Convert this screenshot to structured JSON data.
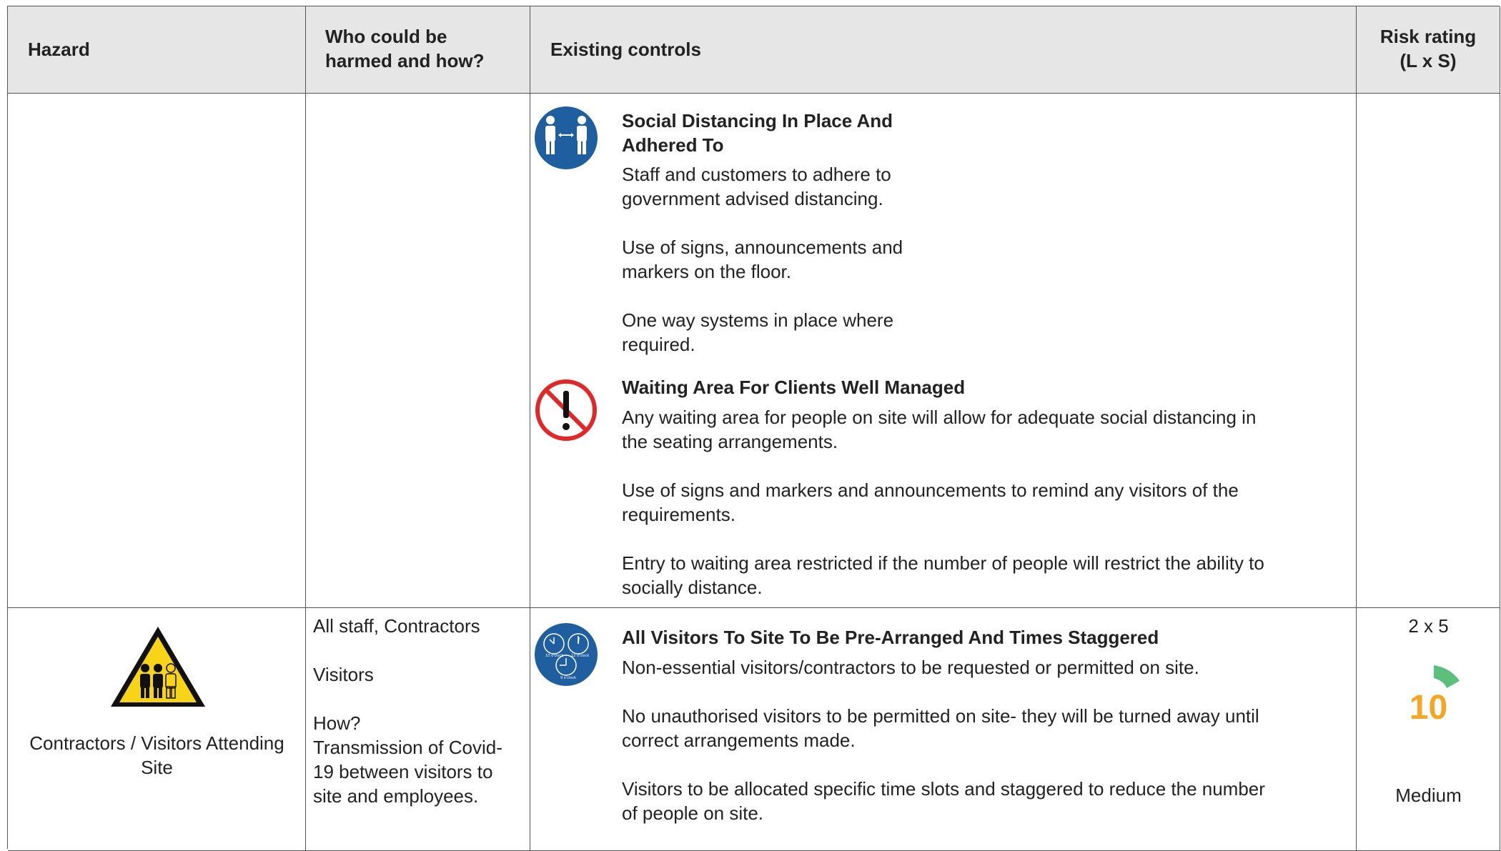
{
  "header": {
    "hazard": "Hazard",
    "who_line1": "Who could be",
    "who_line2": "harmed and how?",
    "controls": "Existing controls",
    "risk_line1": "Risk rating",
    "risk_line2": "(L x S)"
  },
  "row1": {
    "controls": [
      {
        "icon": "social-distancing-icon",
        "title_line1": "Social Distancing In Place And",
        "title_line2": "Adhered To",
        "paragraphs": [
          [
            "Staff and customers to adhere to",
            "government advised distancing."
          ],
          [
            "Use of signs, announcements and",
            "markers on the floor."
          ],
          [
            "One way systems in place where",
            "required."
          ]
        ]
      },
      {
        "icon": "no-waiting-warning-icon",
        "title": "Waiting Area For Clients Well Managed",
        "paragraphs": [
          [
            "Any waiting area for people on site will allow for adequate social distancing in",
            "the seating arrangements."
          ],
          [
            "Use of signs and markers and announcements to remind any visitors of the",
            "requirements."
          ],
          [
            "Entry to waiting area restricted if the number of people will restrict the ability to",
            "socially distance."
          ]
        ]
      }
    ]
  },
  "row2": {
    "hazard_icon": "visitors-warning-triangle-icon",
    "hazard_line1": "Contractors / Visitors Attending",
    "hazard_line2": "Site",
    "who": {
      "line1": "All staff, Contractors",
      "line2": "Visitors",
      "how_label": "How?",
      "how_lines": [
        "Transmission of Covid-",
        "19 between visitors to",
        "site and employees."
      ]
    },
    "control": {
      "icon": "staggered-times-clock-icon",
      "clock_labels": [
        "10 o'clock",
        "12 o'clock",
        "9 o'clock"
      ],
      "title": "All Visitors To Site To Be Pre-Arranged And Times Staggered",
      "paragraphs": [
        [
          "Non-essential visitors/contractors to be requested or permitted on site."
        ],
        [
          "No unauthorised visitors to be permitted on site- they will be turned away until",
          "correct arrangements made."
        ],
        [
          "Visitors to be allocated specific time slots and staggered to reduce the number",
          "of people on site."
        ]
      ]
    },
    "risk": {
      "formula": "2 x 5",
      "score": "10",
      "level": "Medium",
      "likelihood": 2,
      "severity": 5,
      "score_color": "#f5a623",
      "gauge_color": "#5cbf7c"
    }
  },
  "colors": {
    "header_bg": "#e6e6e6",
    "icon_blue": "#1f5fa0",
    "prohibition_red": "#e02828",
    "warning_yellow": "#f7d417"
  }
}
